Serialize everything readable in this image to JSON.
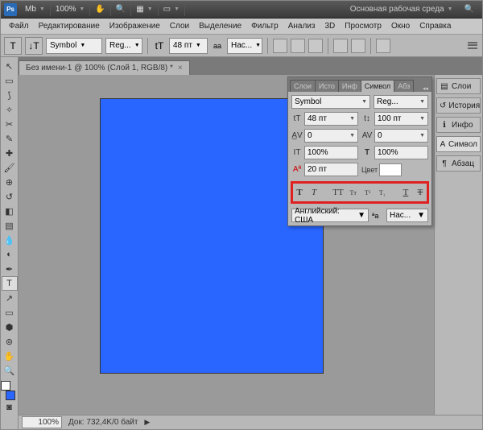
{
  "topbar": {
    "app": "Ps",
    "mb": "Mb",
    "zoom": "100%",
    "workspace": "Основная рабочая среда"
  },
  "menu": [
    "Файл",
    "Редактирование",
    "Изображение",
    "Слои",
    "Выделение",
    "Фильтр",
    "Анализ",
    "3D",
    "Просмотр",
    "Окно",
    "Справка"
  ],
  "options": {
    "font_family": "Symbol",
    "font_style": "Reg...",
    "size_label": "tT",
    "size": "48 пт",
    "aa_prefix": "aa",
    "aa": "Нас..."
  },
  "tab": {
    "title": "Без имени-1 @ 100% (Слой 1, RGB/8) *"
  },
  "status": {
    "zoom": "100%",
    "doc": "Док: 732,4K/0 байт"
  },
  "right_panels": [
    {
      "icon": "layers",
      "label": "Слои"
    },
    {
      "icon": "history",
      "label": "История"
    },
    {
      "icon": "info",
      "label": "Инфо"
    },
    {
      "icon": "char",
      "label": "Символ",
      "active": true
    },
    {
      "icon": "para",
      "label": "Абзац"
    }
  ],
  "char_panel": {
    "tabs": [
      "Слои",
      "Исто",
      "Инф",
      "Символ",
      "Абз"
    ],
    "active_tab": "Символ",
    "font_family": "Symbol",
    "font_style": "Reg...",
    "size": "48 пт",
    "leading": "100 пт",
    "kerning": "0",
    "tracking": "0",
    "vscale": "100%",
    "hscale": "100%",
    "baseline": "20 пт",
    "color_label": "Цвет",
    "lang": "Английский: США",
    "aa": "Нас..."
  }
}
